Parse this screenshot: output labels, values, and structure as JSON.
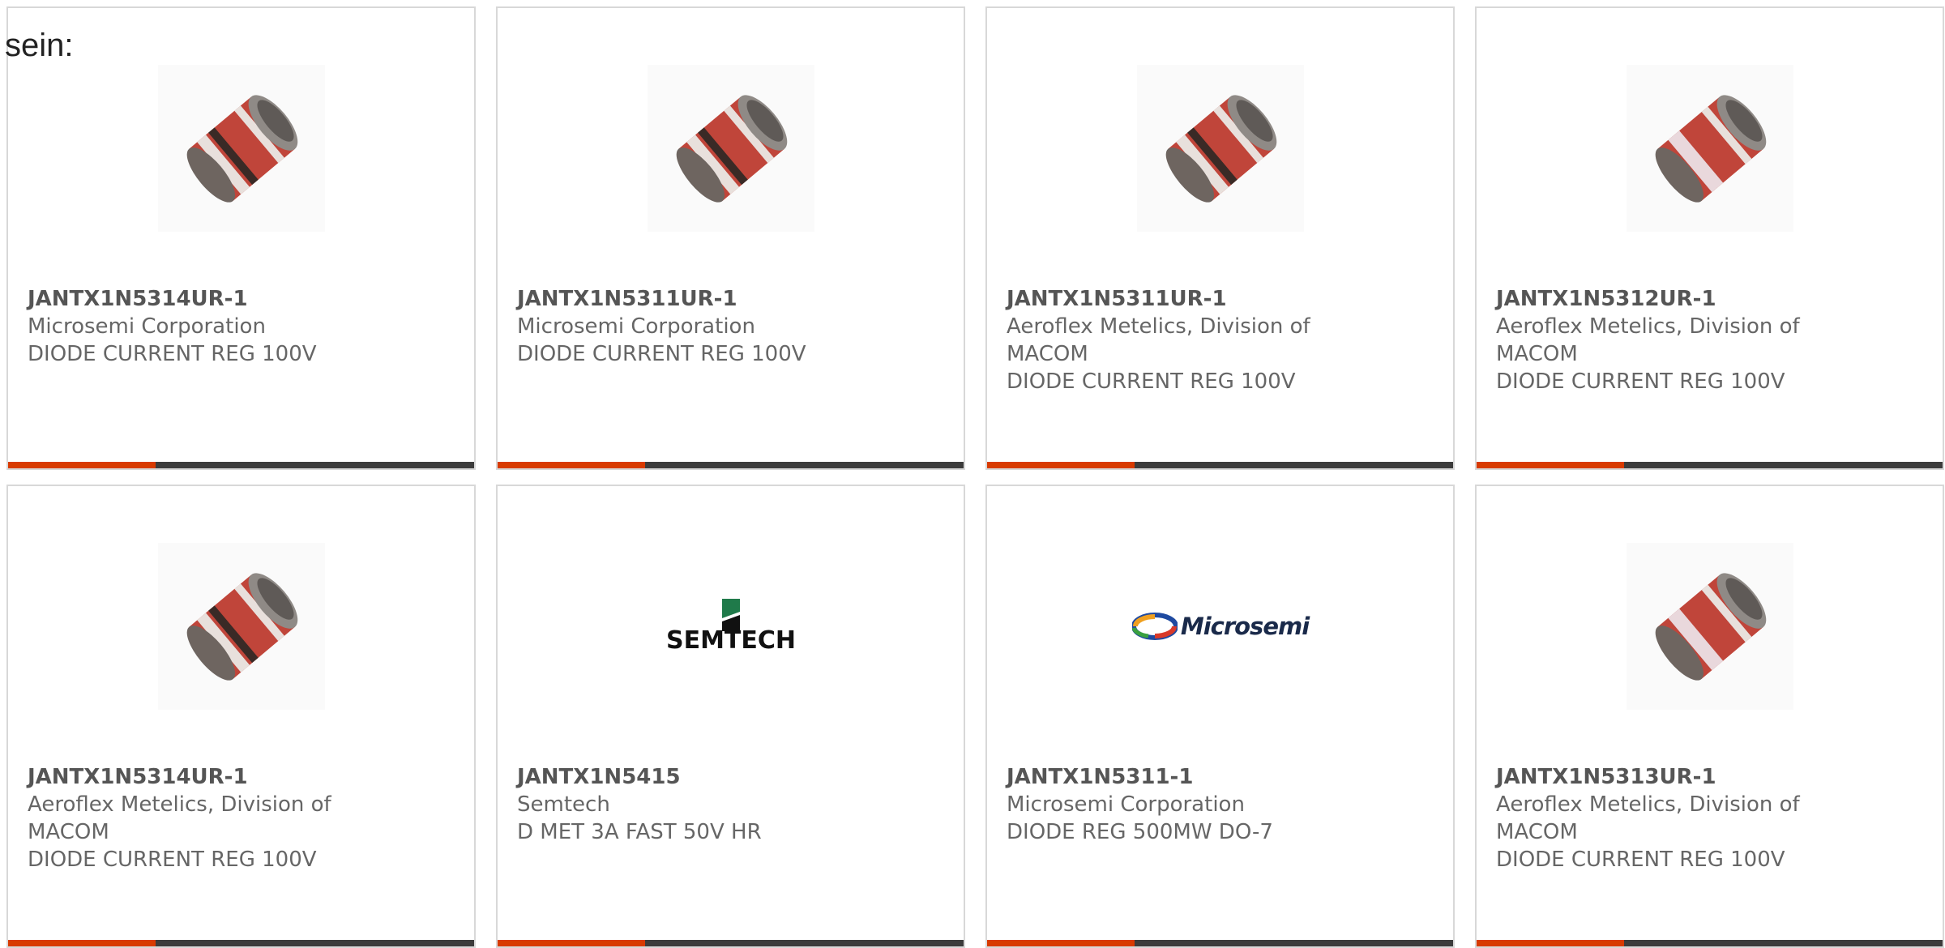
{
  "intro_text": "sein:",
  "products": [
    {
      "part": "JANTX1N5314UR-1",
      "manufacturer": "Microsemi Corporation",
      "description": "DIODE CURRENT REG 100V",
      "image": "diode-dark-band-icon"
    },
    {
      "part": "JANTX1N5311UR-1",
      "manufacturer": "Microsemi Corporation",
      "description": "DIODE CURRENT REG 100V",
      "image": "diode-dark-band-icon"
    },
    {
      "part": "JANTX1N5311UR-1",
      "manufacturer": "Aeroflex Metelics, Division of MACOM",
      "description": "DIODE CURRENT REG 100V",
      "image": "diode-dark-band-icon"
    },
    {
      "part": "JANTX1N5312UR-1",
      "manufacturer": "Aeroflex Metelics, Division of MACOM",
      "description": "DIODE CURRENT REG 100V",
      "image": "diode-light-band-icon"
    },
    {
      "part": "JANTX1N5314UR-1",
      "manufacturer": "Aeroflex Metelics, Division of MACOM",
      "description": "DIODE CURRENT REG 100V",
      "image": "diode-dark-band-icon"
    },
    {
      "part": "JANTX1N5415",
      "manufacturer": "Semtech",
      "description": "D MET 3A FAST 50V HR",
      "image": "semtech-logo",
      "logo_text": "SEMTECH"
    },
    {
      "part": "JANTX1N5311-1",
      "manufacturer": "Microsemi Corporation",
      "description": "DIODE REG 500MW DO-7",
      "image": "microsemi-logo",
      "logo_text": "Microsemi"
    },
    {
      "part": "JANTX1N5313UR-1",
      "manufacturer": "Aeroflex Metelics, Division of MACOM",
      "description": "DIODE CURRENT REG 100V",
      "image": "diode-light-band-icon"
    }
  ],
  "colors": {
    "accent": "#d83b01",
    "bar": "#3c3c3c",
    "card_border": "#d8d8d8",
    "text": "#666666",
    "diode_body": "#c0453a"
  }
}
